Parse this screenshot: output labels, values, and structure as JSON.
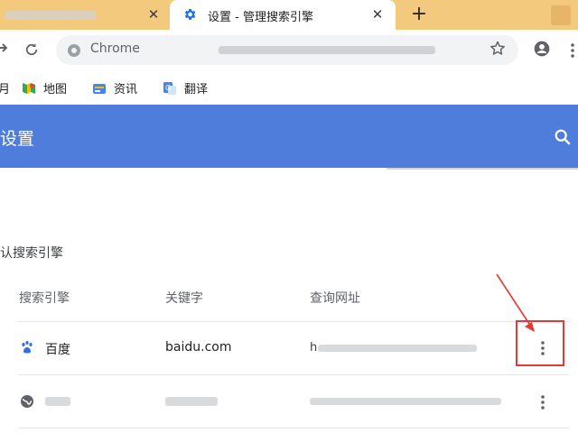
{
  "tabs": [
    {
      "title": "",
      "close": "✕"
    },
    {
      "title": "设置 - 管理搜索引擎",
      "close": "✕"
    }
  ],
  "new_tab_label": "+",
  "omnibox": {
    "chip": "Chrome",
    "url": ""
  },
  "bookmarks": [
    {
      "label": "月"
    },
    {
      "label": "地图"
    },
    {
      "label": "资讯"
    },
    {
      "label": "翻译"
    }
  ],
  "header": {
    "title": "设置"
  },
  "section": {
    "title": "认搜索引擎"
  },
  "columns": [
    "搜索引擎",
    "关键字",
    "查询网址"
  ],
  "rows": [
    {
      "name": "百度",
      "keyword": "baidu.com",
      "url": "h                  =..."
    },
    {
      "name": "",
      "keyword": "",
      "url": ""
    }
  ],
  "colors": {
    "header": "#4f7ddc",
    "tabstrip": "#f2c97d",
    "callout": "#e53935"
  }
}
